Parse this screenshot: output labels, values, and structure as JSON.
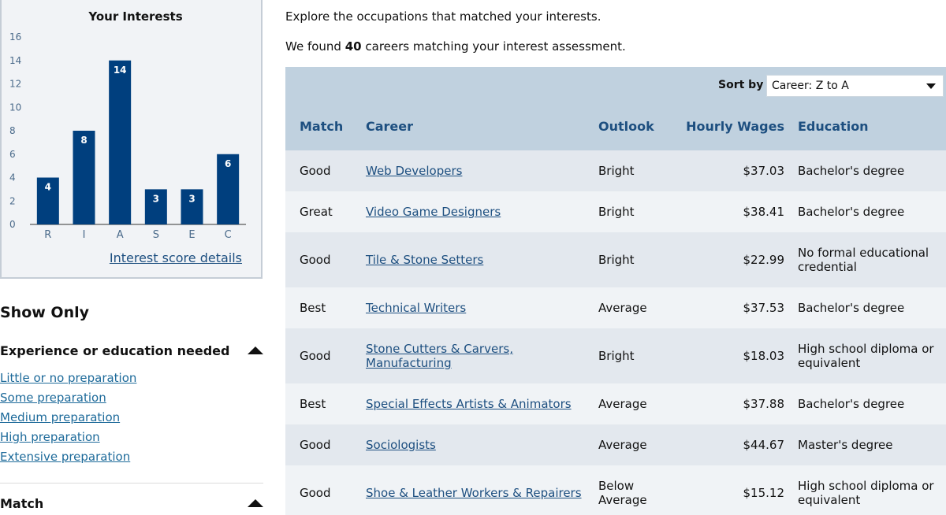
{
  "chart_data": {
    "type": "bar",
    "title": "Your Interests",
    "categories": [
      "R",
      "I",
      "A",
      "S",
      "E",
      "C"
    ],
    "values": [
      4,
      8,
      14,
      3,
      3,
      6
    ],
    "ylim": [
      0,
      16
    ],
    "yticks": [
      0,
      2,
      4,
      6,
      8,
      10,
      12,
      14,
      16
    ],
    "grid": false,
    "bar_color": "#003f7e"
  },
  "chart_link": "Interest score details",
  "filters": {
    "title": "Show Only",
    "experience": {
      "label": "Experience or education needed",
      "options": [
        "Little or no preparation",
        "Some preparation",
        "Medium preparation",
        "High preparation",
        "Extensive preparation"
      ]
    },
    "match": {
      "label": "Match"
    }
  },
  "intro": "Explore the occupations that matched your interests.",
  "found": {
    "prefix": "We found",
    "count": "40",
    "suffix": "careers matching your interest assessment."
  },
  "sort": {
    "label": "Sort by",
    "value": "Career: Z to A"
  },
  "columns": [
    "Match",
    "Career",
    "Outlook",
    "Hourly Wages",
    "Education"
  ],
  "rows": [
    {
      "match": "Good",
      "career": "Web Developers",
      "outlook": "Bright",
      "wage": "$37.03",
      "education": "Bachelor's degree"
    },
    {
      "match": "Great",
      "career": "Video Game Designers",
      "outlook": "Bright",
      "wage": "$38.41",
      "education": "Bachelor's degree"
    },
    {
      "match": "Good",
      "career": "Tile & Stone Setters",
      "outlook": "Bright",
      "wage": "$22.99",
      "education": "No formal educational credential"
    },
    {
      "match": "Best",
      "career": "Technical Writers",
      "outlook": "Average",
      "wage": "$37.53",
      "education": "Bachelor's degree"
    },
    {
      "match": "Good",
      "career": "Stone Cutters & Carvers, Manufacturing",
      "outlook": "Bright",
      "wage": "$18.03",
      "education": "High school diploma or equivalent"
    },
    {
      "match": "Best",
      "career": "Special Effects Artists & Animators",
      "outlook": "Average",
      "wage": "$37.88",
      "education": "Bachelor's degree"
    },
    {
      "match": "Good",
      "career": "Sociologists",
      "outlook": "Average",
      "wage": "$44.67",
      "education": "Master's degree"
    },
    {
      "match": "Good",
      "career": "Shoe & Leather Workers & Repairers",
      "outlook": "Below Average",
      "wage": "$15.12",
      "education": "High school diploma or equivalent"
    }
  ]
}
